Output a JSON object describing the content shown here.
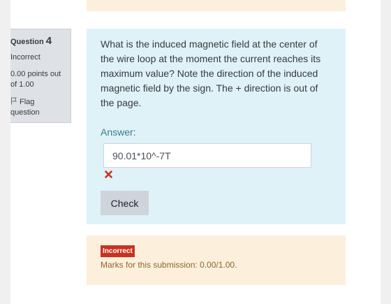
{
  "question_info": {
    "question_label": "Question",
    "question_number": "4",
    "state": "Incorrect",
    "grade_line1": "0.00 points out",
    "grade_line2": "of 1.00",
    "flag_line1": "Flag",
    "flag_line2": "question"
  },
  "question": {
    "text": "What is the induced magnetic field at the center of the wire loop at the moment the current reaches its maximum value? Note the direction of the induced magnetic field by the sign. The + direction is out of the page.",
    "answer_label": "Answer:",
    "answer_value": "90.01*10^-7T",
    "check_label": "Check"
  },
  "feedback": {
    "badge": "Incorrect",
    "marks_text": "Marks for this submission: 0.00/1.00."
  },
  "colors": {
    "info_bg": "#dee2e6",
    "formulation_bg": "#def2f8",
    "feedback_bg": "#fcefdc",
    "incorrect_red": "#ca3120",
    "answer_label": "#3b7d8d"
  },
  "icons": {
    "flag": "flag-outline-icon",
    "incorrect": "red-x-icon"
  }
}
